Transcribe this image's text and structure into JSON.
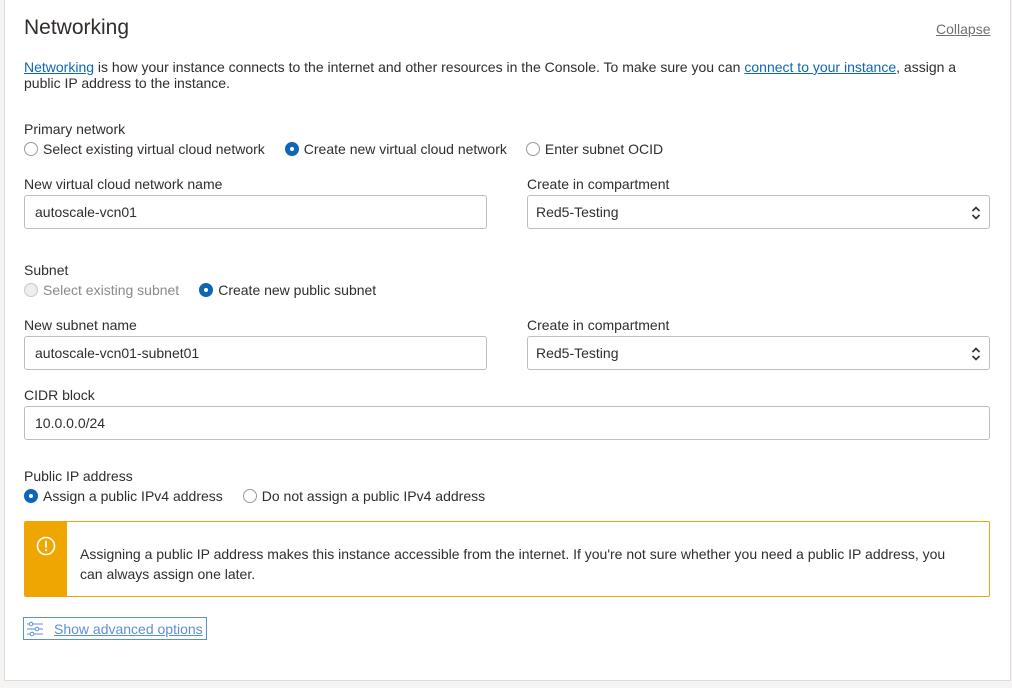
{
  "header": {
    "title": "Networking",
    "collapse_label": "Collapse"
  },
  "description": {
    "link1": "Networking",
    "text1": " is how your instance connects to the internet and other resources in the Console. To make sure you can ",
    "link2": "connect to your instance",
    "text2": ", assign a public IP address to the instance."
  },
  "primary_network": {
    "label": "Primary network",
    "options": [
      {
        "label": "Select existing virtual cloud network",
        "checked": false
      },
      {
        "label": "Create new virtual cloud network",
        "checked": true
      },
      {
        "label": "Enter subnet OCID",
        "checked": false
      }
    ]
  },
  "vcn": {
    "name_label": "New virtual cloud network name",
    "name_value": "autoscale-vcn01",
    "compartment_label": "Create in compartment",
    "compartment_value": "Red5-Testing"
  },
  "subnet": {
    "label": "Subnet",
    "options": [
      {
        "label": "Select existing subnet",
        "checked": false,
        "disabled": true
      },
      {
        "label": "Create new public subnet",
        "checked": true,
        "disabled": false
      }
    ],
    "name_label": "New subnet name",
    "name_value": "autoscale-vcn01-subnet01",
    "compartment_label": "Create in compartment",
    "compartment_value": "Red5-Testing",
    "cidr_label": "CIDR block",
    "cidr_value": "10.0.0.0/24"
  },
  "public_ip": {
    "label": "Public IP address",
    "options": [
      {
        "label": "Assign a public IPv4 address",
        "checked": true
      },
      {
        "label": "Do not assign a public IPv4 address",
        "checked": false
      }
    ]
  },
  "warning": {
    "icon": "exclamation-circle-icon",
    "message": "Assigning a public IP address makes this instance accessible from the internet. If you're not sure whether you need a public IP address, you can always assign one later."
  },
  "advanced": {
    "icon": "sliders-icon",
    "label": "Show advanced options"
  },
  "colors": {
    "link": "#0d67b6",
    "radio_checked": "#0d67b6",
    "warning": "#f0a600",
    "text": "#312d2a"
  }
}
